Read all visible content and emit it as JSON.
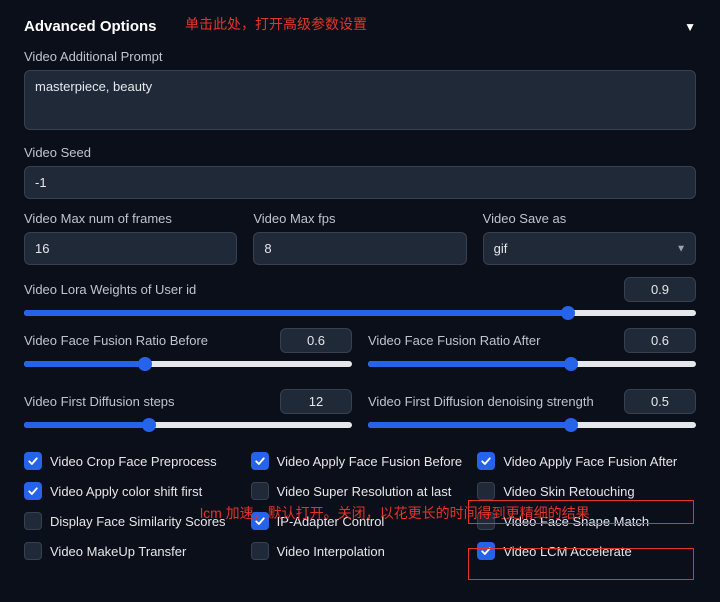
{
  "header": {
    "title": "Advanced Options",
    "annotation": "单击此处，打开高级参数设置"
  },
  "prompt": {
    "label": "Video Additional Prompt",
    "value": "masterpiece, beauty"
  },
  "seed": {
    "label": "Video Seed",
    "value": "-1"
  },
  "max_frames": {
    "label": "Video Max num of frames",
    "value": "16"
  },
  "max_fps": {
    "label": "Video Max fps",
    "value": "8"
  },
  "save_as": {
    "label": "Video Save as",
    "value": "gif"
  },
  "lora": {
    "label": "Video Lora Weights of User id",
    "value": "0.9",
    "pct": 81
  },
  "fusion_before": {
    "label": "Video Face Fusion Ratio Before",
    "value": "0.6",
    "pct": 37
  },
  "fusion_after": {
    "label": "Video Face Fusion Ratio After",
    "value": "0.6",
    "pct": 62
  },
  "diff_steps": {
    "label": "Video First Diffusion steps",
    "value": "12",
    "pct": 38
  },
  "diff_denoise": {
    "label": "Video First Diffusion denoising strength",
    "value": "0.5",
    "pct": 62
  },
  "checks": {
    "crop_face": {
      "label": "Video Crop Face Preprocess",
      "checked": true
    },
    "apply_before": {
      "label": "Video Apply Face Fusion Before",
      "checked": true
    },
    "apply_after": {
      "label": "Video Apply Face Fusion After",
      "checked": true
    },
    "color_shift": {
      "label": "Video Apply color shift first",
      "checked": true
    },
    "super_res": {
      "label": "Video Super Resolution at last",
      "checked": false
    },
    "skin": {
      "label": "Video Skin Retouching",
      "checked": false
    },
    "similarity": {
      "label": "Display Face Similarity Scores",
      "checked": false
    },
    "ipadapter": {
      "label": "IP-Adapter Control",
      "checked": true
    },
    "face_shape": {
      "label": "Video Face Shape Match",
      "checked": false
    },
    "makeup": {
      "label": "Video MakeUp Transfer",
      "checked": false
    },
    "interp": {
      "label": "Video Interpolation",
      "checked": false
    },
    "lcm": {
      "label": "Video LCM Accelerate",
      "checked": true
    }
  },
  "annotation2": "lcm 加速，默认打开。关闭，以花更长的时间得到更精细的结果"
}
